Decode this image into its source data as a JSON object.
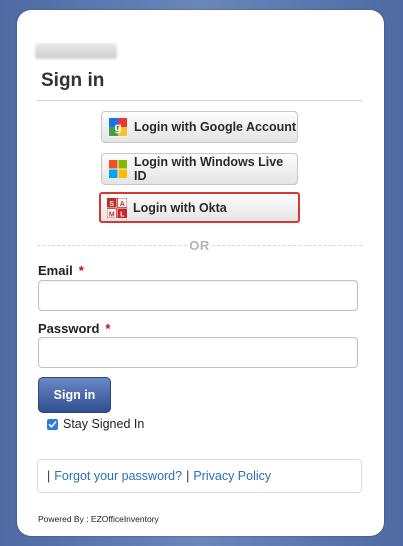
{
  "page": {
    "title": "Sign in",
    "background_color": "#5d78ad"
  },
  "sso": {
    "google_label": "Login with Google Account",
    "windows_label": "Login with Windows Live ID",
    "okta_label": "Login with Okta",
    "okta_icon_letters": [
      "S",
      "A",
      "M",
      "L"
    ],
    "highlight_color": "#d2392f"
  },
  "divider": {
    "text": "OR"
  },
  "form": {
    "email_label": "Email",
    "email_required": "*",
    "email_value": "",
    "password_label": "Password",
    "password_required": "*",
    "password_value": "",
    "submit_label": "Sign in",
    "stay_signed_in_label": "Stay Signed In",
    "stay_signed_in_checked": true
  },
  "links": {
    "leading_separator": "|",
    "forgot_password": "Forgot your password?",
    "separator": "|",
    "privacy_policy": "Privacy Policy"
  },
  "footer": {
    "powered_by": "Powered By : EZOfficeInventory"
  }
}
